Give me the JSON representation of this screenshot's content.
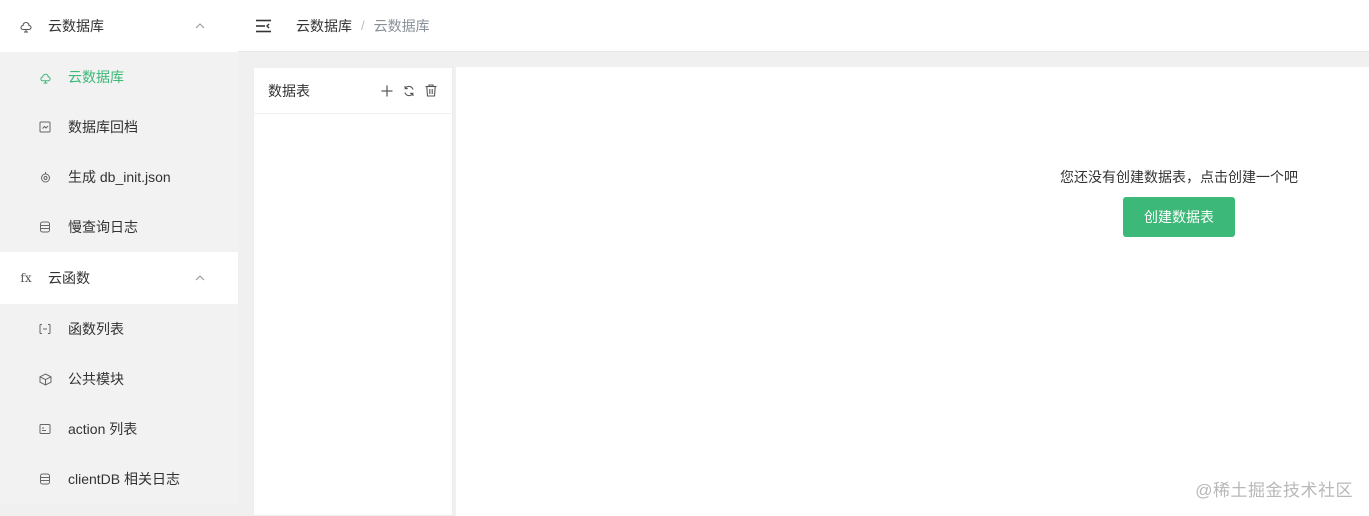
{
  "sidebar": {
    "groups": [
      {
        "icon": "cloud-db-icon",
        "label": "云数据库",
        "expanded": true,
        "items": [
          {
            "icon": "cloud-db-icon",
            "label": "云数据库",
            "active": true
          },
          {
            "icon": "archive-icon",
            "label": "数据库回档"
          },
          {
            "icon": "generate-icon",
            "label": "生成 db_init.json"
          },
          {
            "icon": "log-icon",
            "label": "慢查询日志"
          }
        ]
      },
      {
        "icon": "fx-icon",
        "icon_text": "fx",
        "label": "云函数",
        "expanded": true,
        "items": [
          {
            "icon": "list-icon",
            "label": "函数列表"
          },
          {
            "icon": "cube-icon",
            "label": "公共模块"
          },
          {
            "icon": "action-icon",
            "label": "action 列表"
          },
          {
            "icon": "log-icon",
            "label": "clientDB 相关日志"
          }
        ]
      }
    ]
  },
  "breadcrumb": {
    "items": [
      "云数据库",
      "云数据库"
    ],
    "separator": "/"
  },
  "table_panel": {
    "title": "数据表"
  },
  "main": {
    "empty_text": "您还没有创建数据表，点击创建一个吧",
    "create_label": "创建数据表"
  },
  "watermark": "@稀土掘金技术社区",
  "colors": {
    "accent": "#3cb878",
    "breadcrumb_muted": "#8a9099"
  }
}
